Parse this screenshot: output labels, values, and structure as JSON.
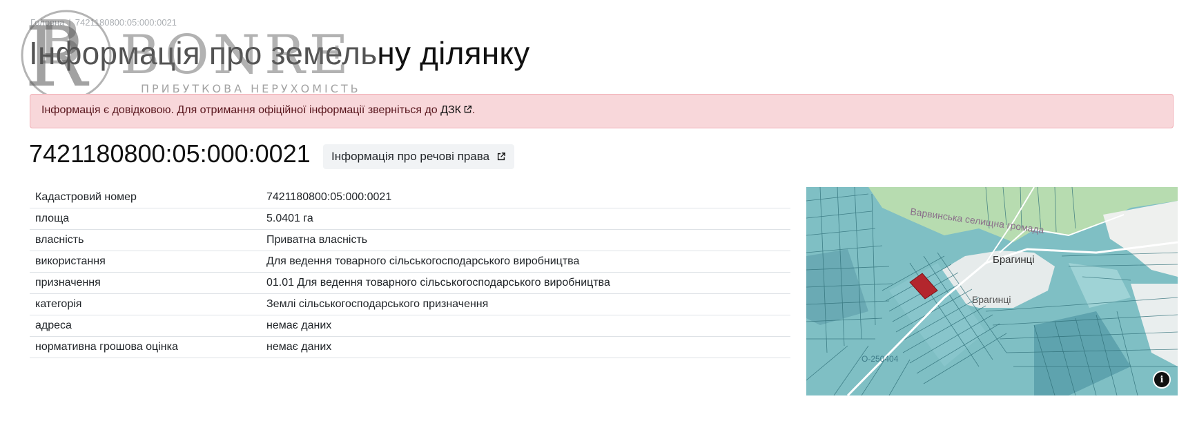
{
  "breadcrumb": {
    "home": "Головна",
    "separator": "|",
    "current": "7421180800:05:000:0021"
  },
  "page_title": "Інформація про земельну ділянку",
  "watermark": {
    "brand": "BONRE",
    "tagline": "ПРИБУТКОВА НЕРУХОМІСТЬ"
  },
  "alert": {
    "text": "Інформація є довідковою. Для отримання офіційної інформації зверніться до",
    "link": "ДЗК",
    "suffix": "."
  },
  "cadastral_number": "7421180800:05:000:0021",
  "rights_button": "Інформація про речові права",
  "table": [
    {
      "label": "Кадастровий номер",
      "value": "7421180800:05:000:0021"
    },
    {
      "label": "площа",
      "value": "5.0401 га"
    },
    {
      "label": "власність",
      "value": "Приватна власність"
    },
    {
      "label": "використання",
      "value": "Для ведення товарного сільськогосподарського виробництва"
    },
    {
      "label": "призначення",
      "value": "01.01 Для ведення товарного сільськогосподарського виробництва"
    },
    {
      "label": "категорія",
      "value": "Землі сільськогосподарського призначення"
    },
    {
      "label": "адреса",
      "value": "немає даних"
    },
    {
      "label": "нормативна грошова оцінка",
      "value": "немає даних"
    }
  ],
  "map": {
    "labels": {
      "community": "Варвинська селищна громада",
      "town1": "Брагинці",
      "town2": "Брагинці",
      "road": "О-250404"
    },
    "colors": {
      "parcel_fill": "#7fbfc4",
      "parcel_line": "#2f6f78",
      "forest": "#b7dcb0",
      "town": "#e8ecec",
      "selected": "#b3262d"
    }
  },
  "icons": {
    "external_link": "external-link-icon",
    "map_info": "info-icon"
  }
}
